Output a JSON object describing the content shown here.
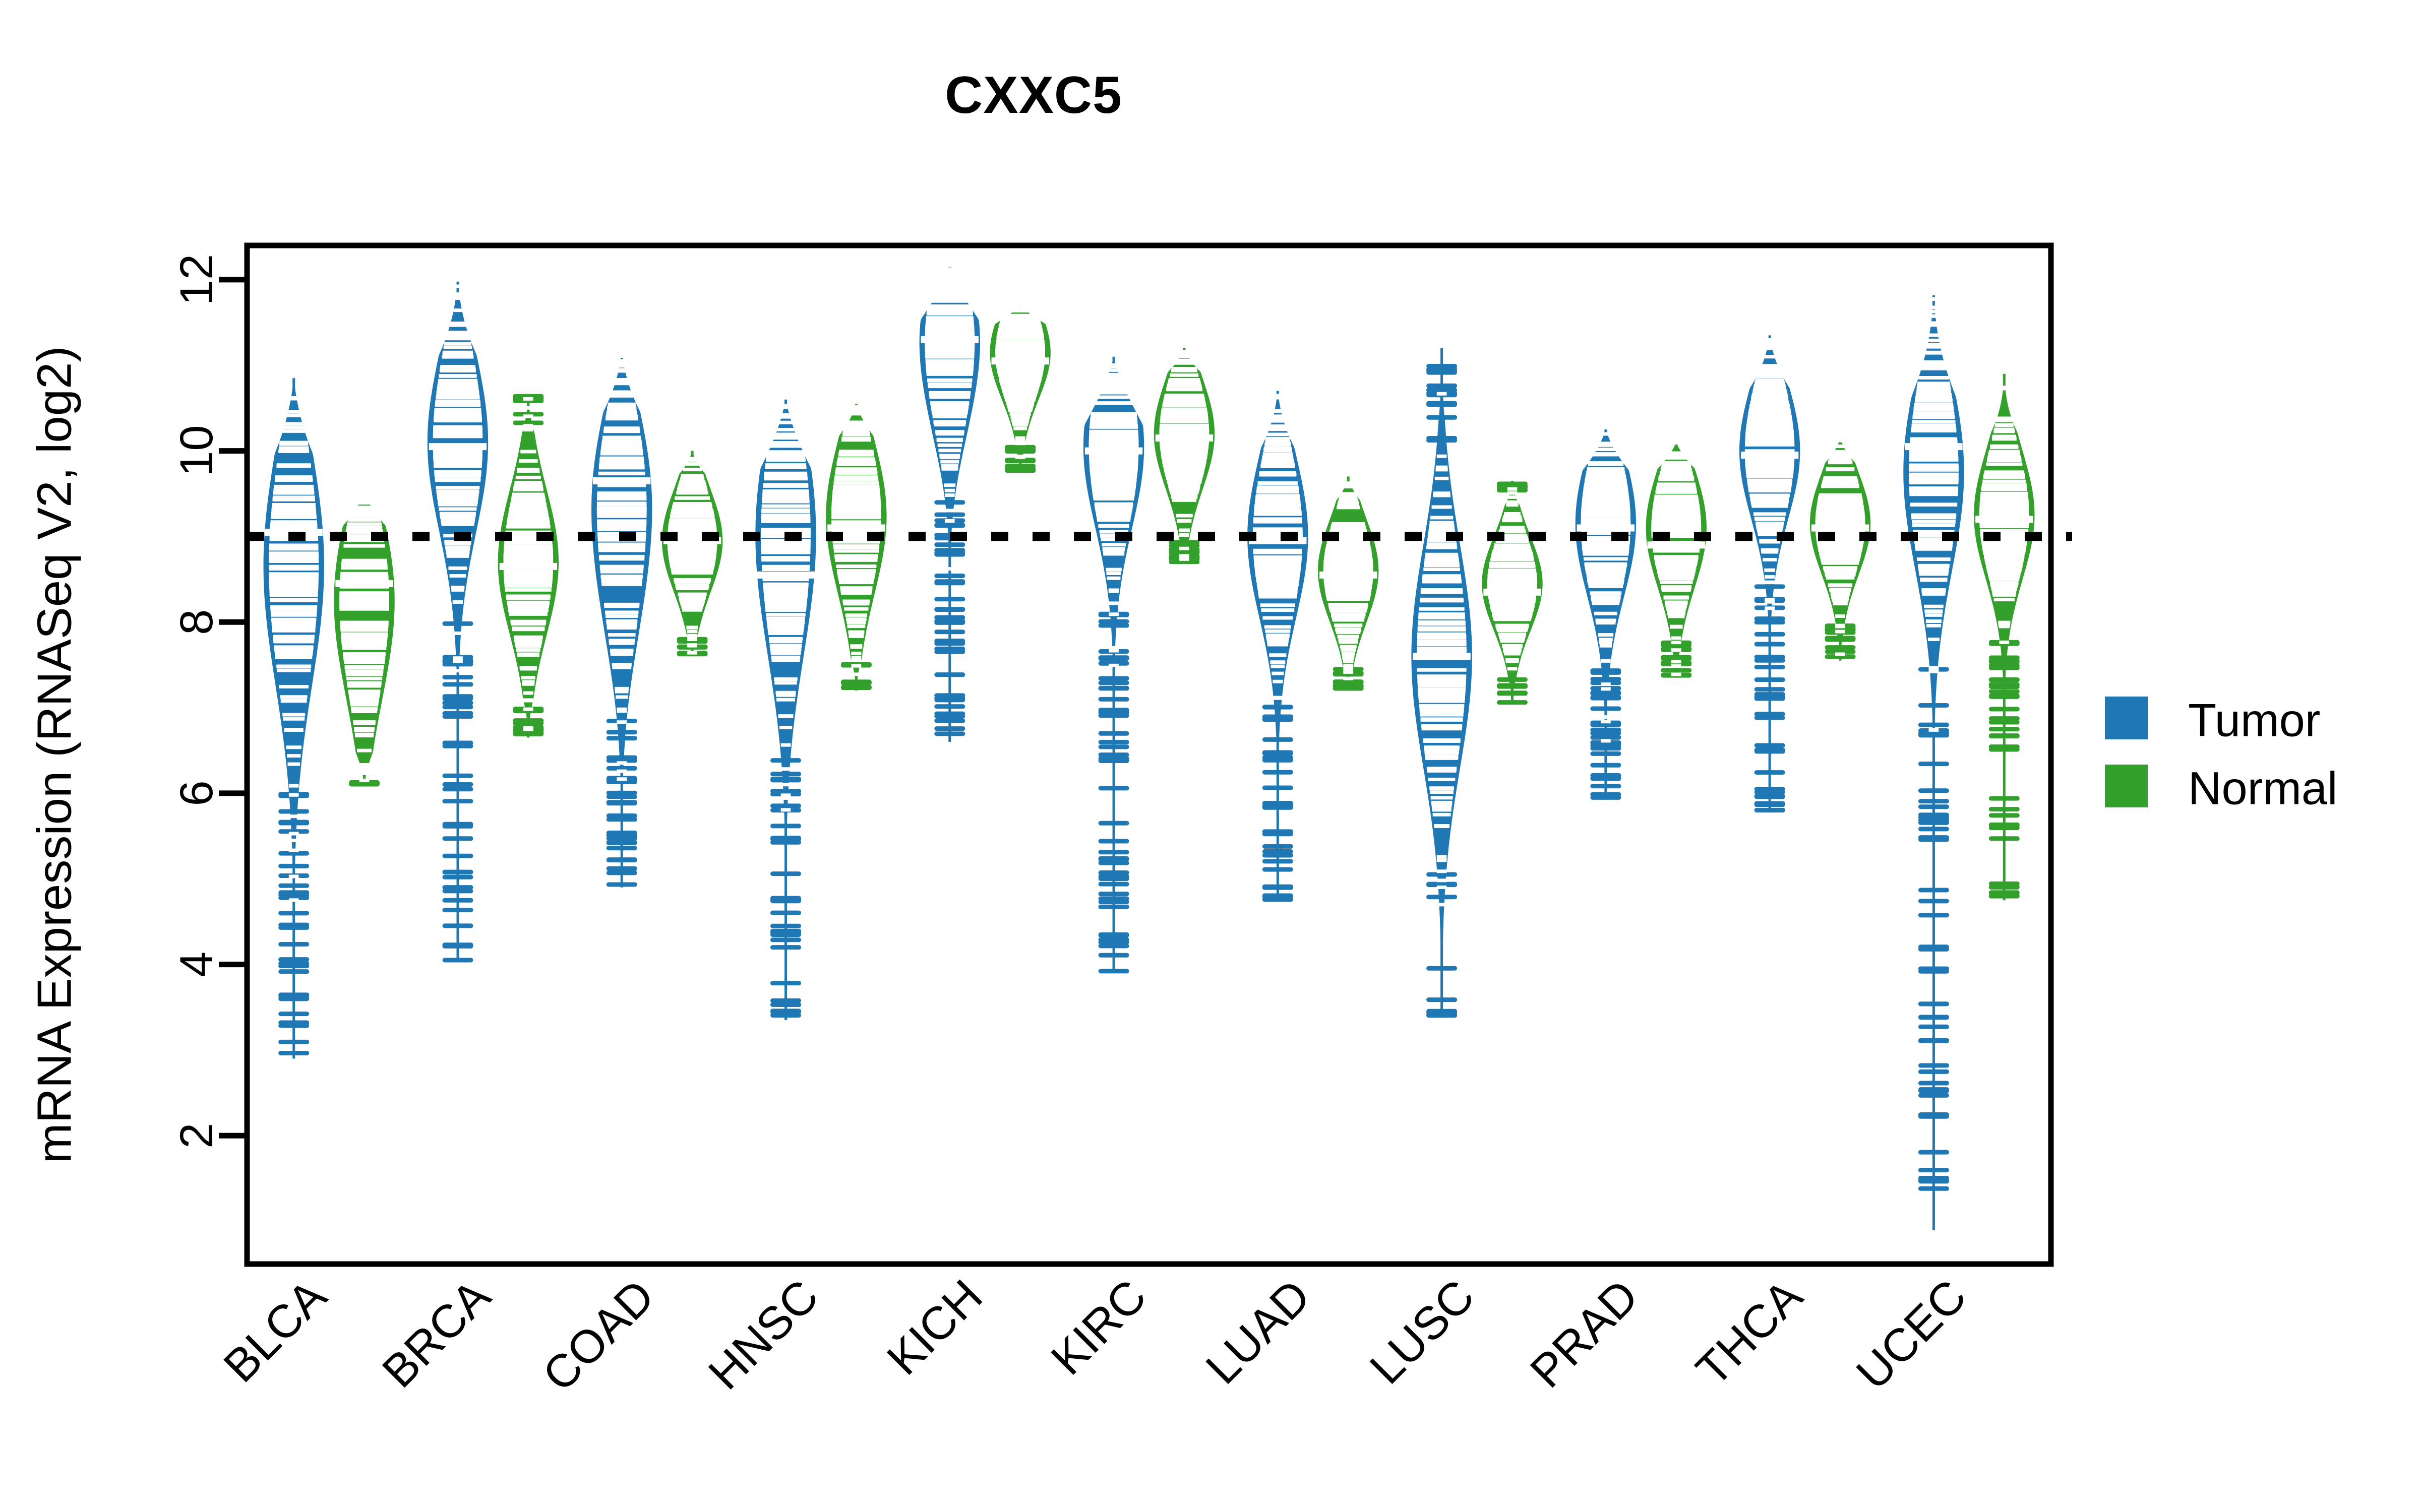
{
  "chart_data": {
    "type": "violin",
    "title": "CXXC5",
    "xlabel": "",
    "ylabel": "mRNA Expression (RNASeq V2, log2)",
    "ylim": [
      0.5,
      12.4
    ],
    "yticks": [
      2,
      4,
      6,
      8,
      10,
      12
    ],
    "ytick_labels": [
      "2",
      "4",
      "6",
      "8",
      "10",
      "12"
    ],
    "grid": false,
    "legend_position": "right",
    "reference_line": {
      "value": 9.0,
      "style": "dotted",
      "color": "#000000"
    },
    "categories": [
      "BLCA",
      "BRCA",
      "COAD",
      "HNSC",
      "KICH",
      "KIRC",
      "LUAD",
      "LUSC",
      "PRAD",
      "THCA",
      "UCEC"
    ],
    "groups": [
      {
        "name": "Tumor",
        "color": "#1f78b4"
      },
      {
        "name": "Normal",
        "color": "#33a02c"
      }
    ],
    "series": [
      {
        "name": "Tumor",
        "color": "#1f78b4",
        "values": [
          {
            "category": "BLCA",
            "median": 9.05,
            "q1": 8.45,
            "q3": 9.6,
            "min": 2.9,
            "max": 10.85,
            "modes": [
              9.05,
              7.95
            ],
            "spread": 1.25
          },
          {
            "category": "BRCA",
            "median": 10.05,
            "q1": 9.4,
            "q3": 10.65,
            "min": 4.05,
            "max": 12.0,
            "modes": [
              10.1
            ],
            "spread": 1.05
          },
          {
            "category": "COAD",
            "median": 9.65,
            "q1": 9.15,
            "q3": 10.1,
            "min": 4.9,
            "max": 11.15,
            "modes": [
              9.7,
              8.3
            ],
            "spread": 0.95
          },
          {
            "category": "HNSC",
            "median": 8.55,
            "q1": 8.0,
            "q3": 9.35,
            "min": 3.35,
            "max": 10.6,
            "modes": [
              9.45,
              8.1
            ],
            "spread": 1.1
          },
          {
            "category": "KICH",
            "median": 11.3,
            "q1": 10.85,
            "q3": 11.7,
            "min": 6.6,
            "max": 12.15,
            "modes": [
              11.55,
              10.5
            ],
            "spread": 0.7
          },
          {
            "category": "KIRC",
            "median": 10.0,
            "q1": 9.35,
            "q3": 10.55,
            "min": 3.9,
            "max": 11.1,
            "modes": [
              10.05
            ],
            "spread": 0.95
          },
          {
            "category": "LUAD",
            "median": 8.95,
            "q1": 8.45,
            "q3": 9.45,
            "min": 4.75,
            "max": 10.7,
            "modes": [
              9.0
            ],
            "spread": 0.95
          },
          {
            "category": "LUSC",
            "median": 7.6,
            "q1": 6.95,
            "q3": 8.35,
            "min": 3.4,
            "max": 11.2,
            "modes": [
              7.6
            ],
            "spread": 1.3
          },
          {
            "category": "PRAD",
            "median": 9.1,
            "q1": 8.65,
            "q3": 9.55,
            "min": 5.95,
            "max": 10.25,
            "modes": [
              9.15
            ],
            "spread": 0.85
          },
          {
            "category": "THCA",
            "median": 9.95,
            "q1": 9.5,
            "q3": 10.35,
            "min": 5.8,
            "max": 11.35,
            "modes": [
              10.0
            ],
            "spread": 0.8
          },
          {
            "category": "UCEC",
            "median": 10.05,
            "q1": 9.35,
            "q3": 10.5,
            "min": 0.9,
            "max": 11.85,
            "modes": [
              10.1,
              9.1
            ],
            "spread": 1.0
          }
        ]
      },
      {
        "name": "Normal",
        "color": "#33a02c",
        "values": [
          {
            "category": "BLCA",
            "median": 8.45,
            "q1": 7.75,
            "q3": 8.95,
            "min": 6.1,
            "max": 9.5,
            "modes": [
              8.6,
              7.5
            ],
            "spread": 0.9
          },
          {
            "category": "BRCA",
            "median": 8.65,
            "q1": 8.15,
            "q3": 9.15,
            "min": 6.65,
            "max": 10.65,
            "modes": [
              8.7
            ],
            "spread": 0.85
          },
          {
            "category": "COAD",
            "median": 8.95,
            "q1": 8.55,
            "q3": 9.35,
            "min": 7.6,
            "max": 10.0,
            "modes": [
              8.95
            ],
            "spread": 0.6
          },
          {
            "category": "HNSC",
            "median": 9.1,
            "q1": 8.65,
            "q3": 9.6,
            "min": 7.2,
            "max": 10.55,
            "modes": [
              9.5,
              8.75
            ],
            "spread": 0.8
          },
          {
            "category": "KICH",
            "median": 11.05,
            "q1": 10.7,
            "q3": 11.35,
            "min": 9.75,
            "max": 11.7,
            "modes": [
              11.15
            ],
            "spread": 0.55
          },
          {
            "category": "KIRC",
            "median": 10.15,
            "q1": 9.75,
            "q3": 10.55,
            "min": 8.7,
            "max": 11.2,
            "modes": [
              10.2
            ],
            "spread": 0.65
          },
          {
            "category": "LUAD",
            "median": 8.55,
            "q1": 8.15,
            "q3": 8.95,
            "min": 7.2,
            "max": 9.7,
            "modes": [
              8.6
            ],
            "spread": 0.6
          },
          {
            "category": "LUSC",
            "median": 8.35,
            "q1": 8.0,
            "q3": 8.75,
            "min": 7.05,
            "max": 9.65,
            "modes": [
              8.45
            ],
            "spread": 0.55
          },
          {
            "category": "PRAD",
            "median": 8.9,
            "q1": 8.45,
            "q3": 9.25,
            "min": 7.35,
            "max": 10.1,
            "modes": [
              9.1
            ],
            "spread": 0.7
          },
          {
            "category": "THCA",
            "median": 9.1,
            "q1": 8.8,
            "q3": 9.45,
            "min": 7.55,
            "max": 10.15,
            "modes": [
              9.15
            ],
            "spread": 0.6
          },
          {
            "category": "UCEC",
            "median": 9.2,
            "q1": 8.85,
            "q3": 9.6,
            "min": 4.75,
            "max": 10.9,
            "modes": [
              9.25
            ],
            "spread": 0.75
          }
        ]
      }
    ]
  },
  "legend": {
    "items": [
      {
        "label": "Tumor",
        "color": "#1f78b4"
      },
      {
        "label": "Normal",
        "color": "#33a02c"
      }
    ]
  },
  "axes": {
    "y_title": "mRNA Expression (RNASeq V2, log2)"
  },
  "title": {
    "text": "CXXC5"
  }
}
